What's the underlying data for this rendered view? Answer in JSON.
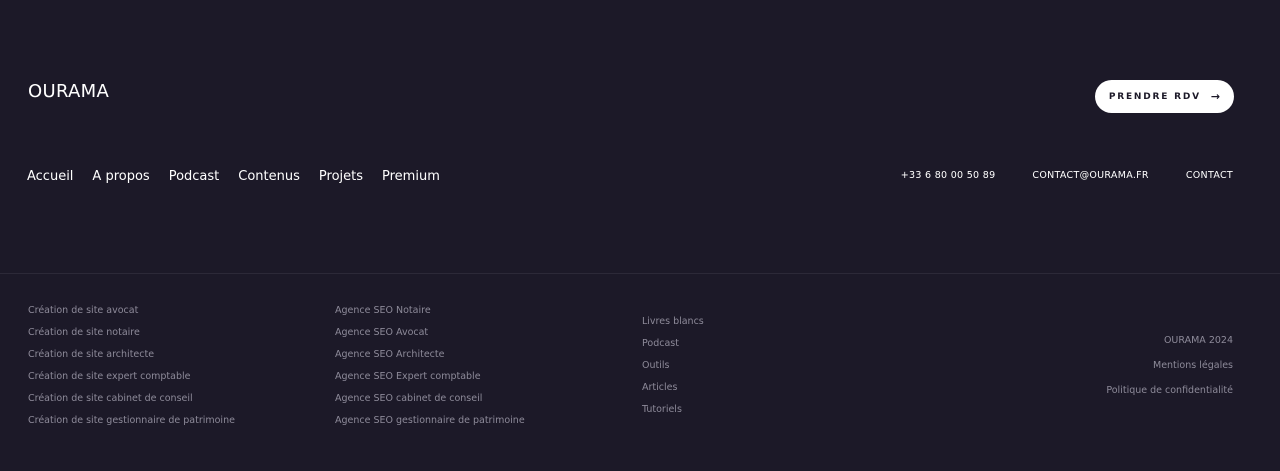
{
  "brand": {
    "name": "OURAMA"
  },
  "cta": {
    "label": "PRENDRE RDV",
    "arrow": "→"
  },
  "main_nav": [
    {
      "label": "Accueil"
    },
    {
      "label": "A propos"
    },
    {
      "label": "Podcast"
    },
    {
      "label": "Contenus"
    },
    {
      "label": "Projets"
    },
    {
      "label": "Premium"
    }
  ],
  "contact": {
    "phone": "+33 6 80 00 50 89",
    "email": "CONTACT@OURAMA.FR",
    "link": "CONTACT"
  },
  "columns": {
    "sites": [
      "Création de site avocat",
      "Création de site notaire",
      "Création de site architecte",
      "Création de site expert comptable",
      "Création de site cabinet de conseil",
      "Création de site gestionnaire de patrimoine"
    ],
    "seo": [
      "Agence SEO Notaire",
      "Agence SEO Avocat",
      "Agence SEO Architecte",
      "Agence SEO Expert comptable",
      "Agence SEO cabinet de conseil",
      "Agence SEO gestionnaire de patrimoine"
    ],
    "resources": [
      "Livres blancs",
      "Podcast",
      "Outils",
      "Articles",
      "Tutoriels"
    ]
  },
  "legal": {
    "copyright": "OURAMA 2024",
    "mentions": "Mentions légales",
    "privacy": "Politique de confidentialité"
  },
  "colors": {
    "background": "#1c1928",
    "text": "#ffffff",
    "muted": "#8d8a99",
    "button_bg": "#ffffff"
  }
}
